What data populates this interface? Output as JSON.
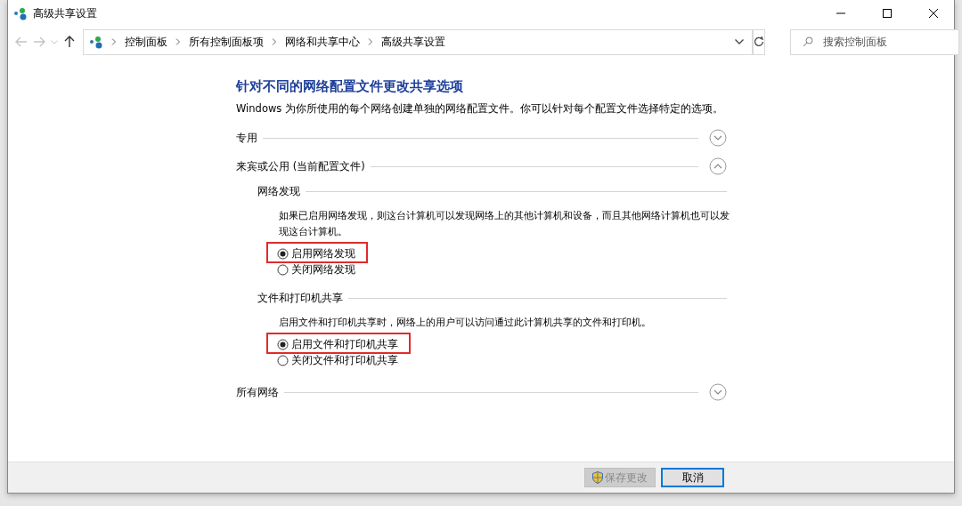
{
  "window": {
    "title": "高级共享设置"
  },
  "nav": {
    "back_disabled": true,
    "forward_disabled": true,
    "breadcrumb": [
      "控制面板",
      "所有控制面板项",
      "网络和共享中心",
      "高级共享设置"
    ],
    "search": {
      "placeholder": "搜索控制面板"
    }
  },
  "heading": "针对不同的网络配置文件更改共享选项",
  "description": "Windows 为你所使用的每个网络创建单独的网络配置文件。你可以针对每个配置文件选择特定的选项。",
  "sections": [
    {
      "label": "专用",
      "expanded": false
    },
    {
      "label": "来宾或公用 (当前配置文件)",
      "expanded": true,
      "groups": [
        {
          "label": "网络发现",
          "description": "如果已启用网络发现，则这台计算机可以发现网络上的其他计算机和设备，而且其他网络计算机也可以发现这台计算机。",
          "options": [
            {
              "label": "启用网络发现",
              "selected": true,
              "highlighted": true
            },
            {
              "label": "关闭网络发现",
              "selected": false,
              "highlighted": false
            }
          ]
        },
        {
          "label": "文件和打印机共享",
          "description": "启用文件和打印机共享时，网络上的用户可以访问通过此计算机共享的文件和打印机。",
          "options": [
            {
              "label": "启用文件和打印机共享",
              "selected": true,
              "highlighted": true
            },
            {
              "label": "关闭文件和打印机共享",
              "selected": false,
              "highlighted": false
            }
          ]
        }
      ]
    },
    {
      "label": "所有网络",
      "expanded": false
    }
  ],
  "buttons": [
    {
      "label": "保存更改",
      "kind": "shield",
      "disabled": true,
      "default": false
    },
    {
      "label": "取消",
      "kind": "plain",
      "disabled": false,
      "default": true
    }
  ]
}
